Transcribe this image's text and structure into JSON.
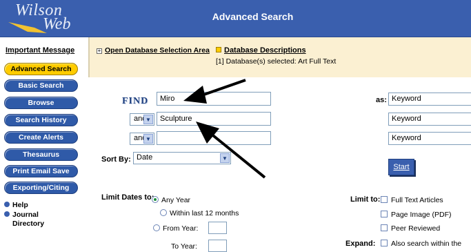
{
  "app": {
    "logo_line1": "Wilson",
    "logo_line2": "Web",
    "page_title": "Advanced Search"
  },
  "sidebar": {
    "important_message": "Important Message",
    "buttons": [
      {
        "label": "Advanced Search",
        "active": true
      },
      {
        "label": "Basic Search",
        "active": false
      },
      {
        "label": "Browse",
        "active": false
      },
      {
        "label": "Search History",
        "active": false
      },
      {
        "label": "Create Alerts",
        "active": false
      },
      {
        "label": "Thesaurus",
        "active": false
      },
      {
        "label": "Print Email Save",
        "active": false
      },
      {
        "label": "Exporting/Citing",
        "active": false
      }
    ],
    "links": [
      "Help",
      "Journal",
      "Directory"
    ]
  },
  "info_bar": {
    "open_db_label": "Open Database Selection Area",
    "db_descriptions_label": "Database Descriptions",
    "db_selected_text": "[1] Database(s) selected: Art Full Text"
  },
  "search": {
    "find_label": "FIND",
    "rows": [
      {
        "boolean": "",
        "term": "Miro",
        "field": "Keyword"
      },
      {
        "boolean": "and",
        "term": "Sculpture",
        "field": "Keyword"
      },
      {
        "boolean": "and",
        "term": "",
        "field": "Keyword"
      }
    ],
    "as_label": "as:",
    "sort_by_label": "Sort By:",
    "sort_by_value": "Date",
    "start_label": "Start"
  },
  "limits": {
    "limit_dates_label": "Limit Dates to:",
    "date_options": [
      {
        "label": "Any Year",
        "selected": true
      },
      {
        "label": "Within last 12 months",
        "selected": false
      },
      {
        "label": "From Year:",
        "selected": false
      }
    ],
    "to_year_label": "To Year:",
    "limit_to_label": "Limit to:",
    "limit_to_options": [
      {
        "label": "Full Text Articles",
        "checked": false
      },
      {
        "label": "Page Image (PDF)",
        "checked": false
      },
      {
        "label": "Peer Reviewed",
        "checked": false
      }
    ],
    "expand_label": "Expand:",
    "expand_option": {
      "label": "Also search within the",
      "checked": false
    }
  },
  "colors": {
    "header_blue": "#3a5fae",
    "active_button": "#ffcc00",
    "info_bar_bg": "#fbf0d2"
  }
}
